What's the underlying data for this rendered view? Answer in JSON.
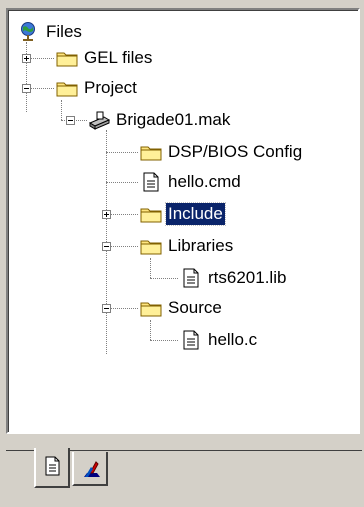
{
  "tree": {
    "root": {
      "label": "Files",
      "icon": "files-globe-icon"
    },
    "items": [
      {
        "label": "GEL files",
        "icon": "folder-icon",
        "expander": "plus"
      },
      {
        "label": "Project",
        "icon": "folder-icon",
        "expander": "minus"
      },
      {
        "label": "Brigade01.mak",
        "icon": "project-file-icon",
        "expander": "minus"
      },
      {
        "label": "DSP/BIOS Config",
        "icon": "folder-icon"
      },
      {
        "label": "hello.cmd",
        "icon": "document-icon"
      },
      {
        "label": "Include",
        "icon": "folder-icon",
        "expander": "plus",
        "selected": true
      },
      {
        "label": "Libraries",
        "icon": "folder-icon",
        "expander": "minus"
      },
      {
        "label": "rts6201.lib",
        "icon": "document-icon"
      },
      {
        "label": "Source",
        "icon": "folder-icon",
        "expander": "minus"
      },
      {
        "label": "hello.c",
        "icon": "document-icon"
      }
    ]
  },
  "tabs": [
    {
      "icon": "file-view-tab-icon",
      "active": true
    },
    {
      "icon": "bookmark-view-tab-icon",
      "active": false
    }
  ],
  "colors": {
    "selection": "#0a246a",
    "folder": "#ffe680",
    "panel": "#d4d0c8"
  }
}
